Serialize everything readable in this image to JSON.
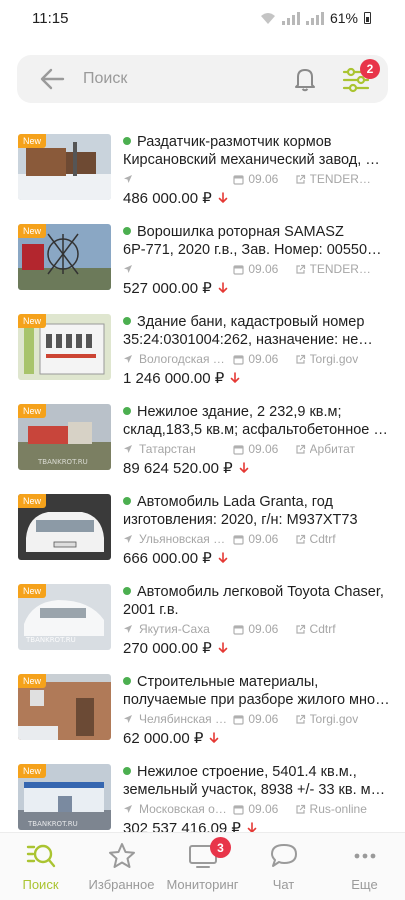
{
  "status_bar": {
    "time": "11:15",
    "battery": "61%"
  },
  "search": {
    "placeholder": "Поиск",
    "value": "",
    "filter_badge": "2"
  },
  "new_label": "New",
  "listings": [
    {
      "title_l1": "Раздатчик-размотчик кормов",
      "title_l2": "Кирсановский механический завод, …",
      "region": "",
      "date": "09.06",
      "source": "TENDER…",
      "price": "486 000.00 ₽",
      "thumb": "snow-yard"
    },
    {
      "title_l1": "Ворошилка роторная SAMASZ",
      "title_l2": "6P-771, 2020 г.в., Зав. Номер: 00550…",
      "region": "",
      "date": "09.06",
      "source": "TENDER…",
      "price": "527 000.00 ₽",
      "thumb": "machine"
    },
    {
      "title_l1": "Здание бани, кадастровый номер",
      "title_l2": "35:24:0301004:262, назначение: не…",
      "region": "Вологодская о…",
      "date": "09.06",
      "source": "Torgi.gov",
      "price": "1 246 000.00 ₽",
      "thumb": "electric"
    },
    {
      "title_l1": "Нежилое здание, 2 232,9 кв.м;",
      "title_l2": "склад,183,5 кв.м; асфальтобетонное …",
      "region": "Татарстан",
      "date": "09.06",
      "source": "Арбитат",
      "price": "89 624 520.00 ₽",
      "thumb": "building-field"
    },
    {
      "title_l1": "Автомобиль Lada Granta, год",
      "title_l2": "изготовления: 2020, г/н: М937ХТ73",
      "region": "Ульяновская о…",
      "date": "09.06",
      "source": "Cdtrf",
      "price": "666 000.00 ₽",
      "thumb": "car-white"
    },
    {
      "title_l1": "Автомобиль легковой Toyota Chaser,",
      "title_l2": "2001 г.в.",
      "region": "Якутия-Саха",
      "date": "09.06",
      "source": "Cdtrf",
      "price": "270 000.00 ₽",
      "thumb": "car-snow"
    },
    {
      "title_l1": "Строительные материалы,",
      "title_l2": "получаемые при разборе жилого мно…",
      "region": "Челябинская о…",
      "date": "09.06",
      "source": "Torgi.gov",
      "price": "62 000.00 ₽",
      "thumb": "old-building"
    },
    {
      "title_l1": "Нежилое строение, 5401.4 кв.м.,",
      "title_l2": "земельный участок, 8938 +/- 33 кв. м…",
      "region": "Московская о…",
      "date": "09.06",
      "source": "Rus-online",
      "price": "302 537 416.09 ₽",
      "thumb": "warehouse"
    }
  ],
  "bottom_nav": [
    {
      "label": "Поиск",
      "icon": "search-icon",
      "active": true
    },
    {
      "label": "Избранное",
      "icon": "star-icon"
    },
    {
      "label": "Мониторинг",
      "icon": "monitor-icon",
      "badge": "3"
    },
    {
      "label": "Чат",
      "icon": "chat-icon"
    },
    {
      "label": "Еще",
      "icon": "more-icon"
    }
  ],
  "colors": {
    "accent": "#aac431",
    "badge": "#e8354a",
    "new_badge": "#f5a21b",
    "active_dot": "#4caf50",
    "price_down": "#e53935"
  }
}
